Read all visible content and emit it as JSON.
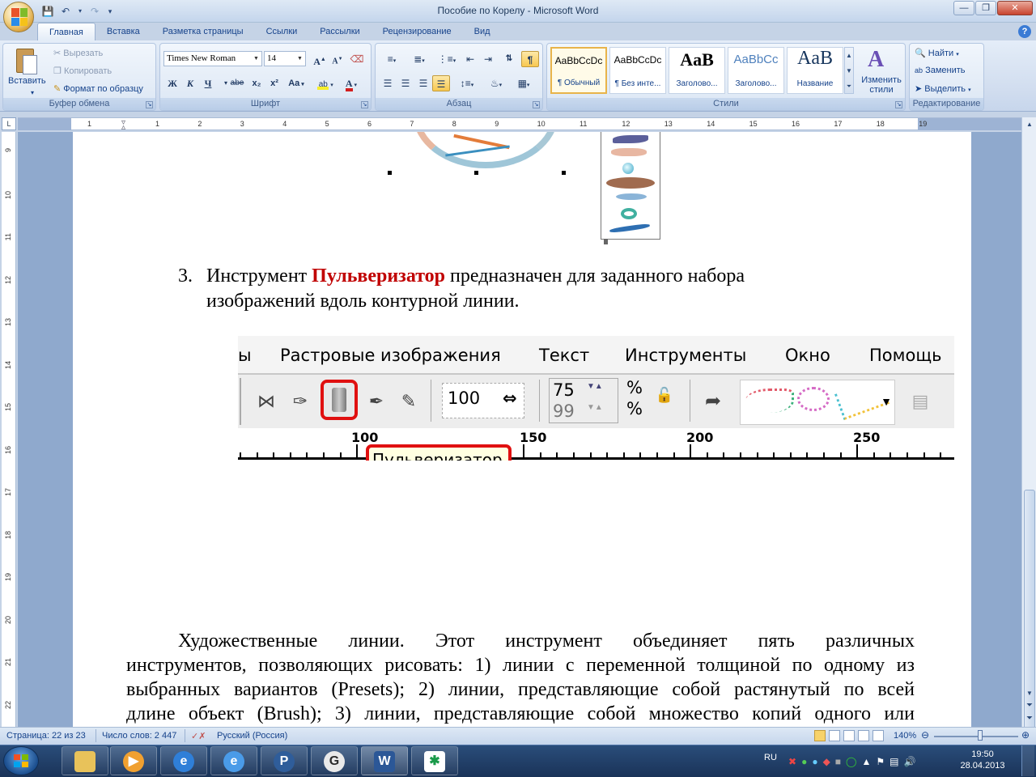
{
  "window": {
    "title": "Пособие по Корелу - Microsoft Word"
  },
  "tabs": [
    "Главная",
    "Вставка",
    "Разметка страницы",
    "Ссылки",
    "Рассылки",
    "Рецензирование",
    "Вид"
  ],
  "ribbon": {
    "clipboard": {
      "paste": "Вставить",
      "cut": "Вырезать",
      "copy": "Копировать",
      "format_painter": "Формат по образцу",
      "label": "Буфер обмена"
    },
    "font": {
      "name": "Times New Roman",
      "size": "14",
      "label": "Шрифт",
      "bold": "Ж",
      "italic": "К",
      "underline": "Ч",
      "strike": "abe",
      "sub": "x₂",
      "sup": "x²",
      "case": "Aa",
      "grow": "A",
      "shrink": "A"
    },
    "paragraph": {
      "label": "Абзац",
      "pilcrow": "¶"
    },
    "styles": {
      "label": "Стили",
      "items": [
        {
          "sample": "AaBbCcDc",
          "name": "¶ Обычный"
        },
        {
          "sample": "AaBbCcDc",
          "name": "¶ Без инте..."
        },
        {
          "sample": "AaB",
          "name": "Заголово..."
        },
        {
          "sample": "AaBbCc",
          "name": "Заголово..."
        },
        {
          "sample": "AaB",
          "name": "Название"
        }
      ],
      "change": "Изменить стили"
    },
    "editing": {
      "find": "Найти",
      "replace": "Заменить",
      "select": "Выделить",
      "label": "Редактирование"
    }
  },
  "ruler": {
    "h_numbers": [
      "1",
      "1",
      "2",
      "3",
      "4",
      "5",
      "6",
      "7",
      "8",
      "9",
      "10",
      "11",
      "12",
      "13",
      "14",
      "15",
      "16",
      "17",
      "18",
      "19"
    ],
    "v_numbers": [
      "9",
      "10",
      "11",
      "12",
      "13",
      "14",
      "15",
      "16",
      "17",
      "18",
      "19",
      "20",
      "21",
      "22"
    ]
  },
  "document": {
    "list_number": "3.",
    "line1_before": "Инструмент ",
    "line1_highlight": "Пульверизатор",
    "line1_after": " предназначен для заданного набора",
    "line2": "изображений вдоль контурной линии.",
    "paragraph_lines": [
      "Художественные линии. Этот инструмент объединяет пять различных",
      "инструментов, позволяющих рисовать: 1) линии с переменной толщиной по одному из",
      "выбранных вариантов (Presets); 2) линии, представляющие собой растянутый по всей",
      "длине объект (Brush); 3) линии, представляющие собой множество копий одного или"
    ],
    "highlight_color": "#c00000"
  },
  "corel": {
    "menu": [
      "ы",
      "Растровые изображения",
      "Текст",
      "Инструменты",
      "Окно",
      "Помощь"
    ],
    "size_value": "100",
    "spacing1": "75",
    "spacing2": "99",
    "percent": "%",
    "ruler_numbers": [
      "100",
      "150",
      "200",
      "250"
    ],
    "tooltip": "Пульверизатор",
    "highlight_color": "#e01010"
  },
  "status": {
    "page": "Страница: 22 из 23",
    "words": "Число слов: 2 447",
    "language": "Русский (Россия)",
    "zoom": "140%"
  },
  "tray": {
    "lang": "RU",
    "time": "19:50",
    "date": "28.04.2013"
  }
}
